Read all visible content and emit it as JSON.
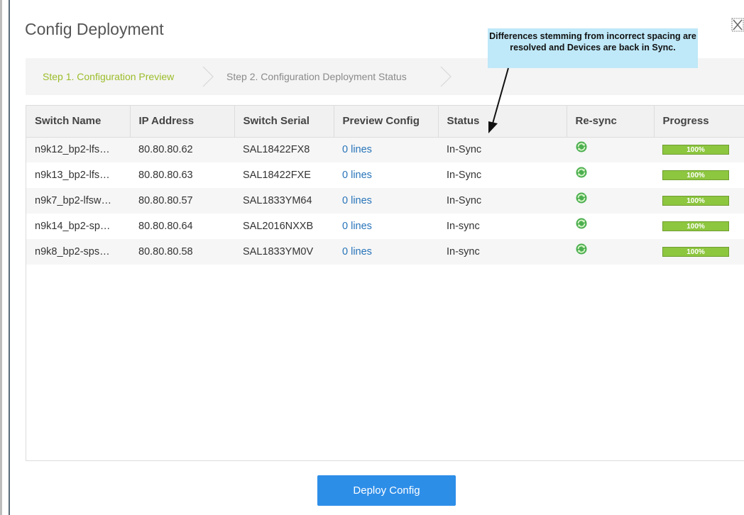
{
  "dialog": {
    "title": "Config Deployment"
  },
  "stepper": {
    "step1": "Step 1. Configuration Preview",
    "step2": "Step 2. Configuration Deployment Status"
  },
  "table": {
    "headers": [
      "Switch Name",
      "IP Address",
      "Switch Serial",
      "Preview Config",
      "Status",
      "Re-sync",
      "Progress"
    ],
    "rows": [
      {
        "switch_name": "n9k12_bp2-lfs…",
        "ip": "80.80.80.62",
        "serial": "SAL18422FX8",
        "preview": "0 lines",
        "status": "In-Sync",
        "progress": "100%"
      },
      {
        "switch_name": "n9k13_bp2-lfs…",
        "ip": "80.80.80.63",
        "serial": "SAL18422FXE",
        "preview": "0 lines",
        "status": "In-Sync",
        "progress": "100%"
      },
      {
        "switch_name": "n9k7_bp2-lfsw…",
        "ip": "80.80.80.57",
        "serial": "SAL1833YM64",
        "preview": "0 lines",
        "status": "In-Sync",
        "progress": "100%"
      },
      {
        "switch_name": "n9k14_bp2-sp…",
        "ip": "80.80.80.64",
        "serial": "SAL2016NXXB",
        "preview": "0 lines",
        "status": "In-sync",
        "progress": "100%"
      },
      {
        "switch_name": "n9k8_bp2-sps…",
        "ip": "80.80.80.58",
        "serial": "SAL1833YM0V",
        "preview": "0 lines",
        "status": "In-sync",
        "progress": "100%"
      }
    ]
  },
  "footer": {
    "deploy_label": "Deploy Config"
  },
  "annotation": {
    "text": "Differences stemming from incorrect spacing are resolved and Devices are back in Sync."
  },
  "icons": {
    "close": "close-icon",
    "resync": "resync-icon",
    "step_separator": "chevron-right-icon"
  },
  "colors": {
    "step_active": "#9bbd2a",
    "link": "#2774b9",
    "progress": "#8dc63f",
    "primary_button": "#2d8ee8",
    "annotation_bg": "#bfe8f8"
  }
}
